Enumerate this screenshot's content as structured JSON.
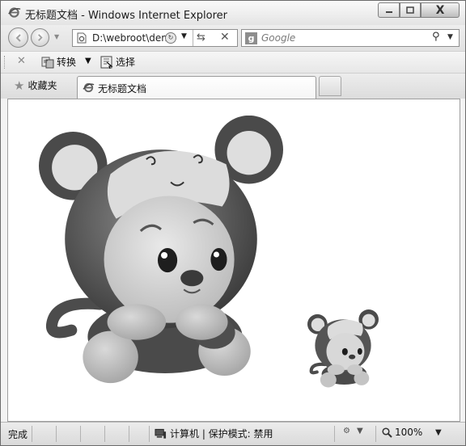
{
  "window": {
    "title": "无标题文档 - Windows Internet Explorer",
    "controls": {
      "minimize": "▭",
      "maximize": "▢",
      "close": "X"
    }
  },
  "navigation": {
    "address": "D:\\webroot\\dem",
    "search_placeholder": "Google",
    "search_provider_icon": "google-g-icon"
  },
  "command_bar": {
    "convert_label": "转换",
    "select_label": "选择"
  },
  "favorites": {
    "label": "收藏夹"
  },
  "tabs": [
    {
      "label": "无标题文档",
      "active": true
    }
  ],
  "content": {
    "images": [
      {
        "name": "large-monkey-plush",
        "alt": "plush monkey toy"
      },
      {
        "name": "small-monkey-plush",
        "alt": "plush monkey toy"
      }
    ]
  },
  "status": {
    "text": "完成",
    "zone": "计算机 | 保护模式: 禁用",
    "zoom": "100%"
  },
  "colors": {
    "chrome": "#e6e6e6",
    "border": "#6b6b6b",
    "content_bg": "#ffffff"
  }
}
